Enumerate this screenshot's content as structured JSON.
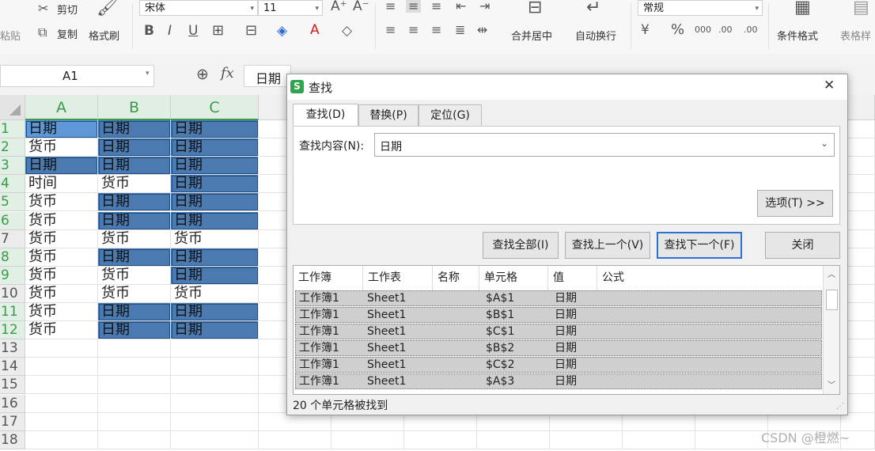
{
  "ribbon": {
    "paste_label": "粘贴",
    "cut_label": "剪切",
    "copy_label": "复制",
    "format_painter_label": "格式刷",
    "font_name": "宋体",
    "font_size": "11",
    "merge_center_label": "合并居中",
    "wrap_text_label": "自动换行",
    "number_format": "常规",
    "cond_format_label": "条件格式",
    "table_style_label": "表格样"
  },
  "formula_bar": {
    "name_box": "A1",
    "fx_label": "fx",
    "content": "日期"
  },
  "sheet": {
    "columns": [
      "A",
      "B",
      "C"
    ],
    "rows": [
      {
        "num": "1",
        "cells": [
          "日期",
          "日期",
          "日期"
        ],
        "hi": [
          true,
          true,
          true
        ],
        "sel": true
      },
      {
        "num": "2",
        "cells": [
          "货币",
          "日期",
          "日期"
        ],
        "hi": [
          false,
          true,
          true
        ],
        "sel": true
      },
      {
        "num": "3",
        "cells": [
          "日期",
          "日期",
          "日期"
        ],
        "hi": [
          true,
          true,
          true
        ],
        "sel": true
      },
      {
        "num": "4",
        "cells": [
          "时间",
          "货币",
          "日期"
        ],
        "hi": [
          false,
          false,
          true
        ],
        "sel": true
      },
      {
        "num": "5",
        "cells": [
          "货币",
          "日期",
          "日期"
        ],
        "hi": [
          false,
          true,
          true
        ],
        "sel": true
      },
      {
        "num": "6",
        "cells": [
          "货币",
          "日期",
          "日期"
        ],
        "hi": [
          false,
          true,
          true
        ],
        "sel": true
      },
      {
        "num": "7",
        "cells": [
          "货币",
          "货币",
          "货币"
        ],
        "hi": [
          false,
          false,
          false
        ],
        "sel": false
      },
      {
        "num": "8",
        "cells": [
          "货币",
          "日期",
          "日期"
        ],
        "hi": [
          false,
          true,
          true
        ],
        "sel": true
      },
      {
        "num": "9",
        "cells": [
          "货币",
          "货币",
          "日期"
        ],
        "hi": [
          false,
          false,
          true
        ],
        "sel": true
      },
      {
        "num": "10",
        "cells": [
          "货币",
          "货币",
          "货币"
        ],
        "hi": [
          false,
          false,
          false
        ],
        "sel": false
      },
      {
        "num": "11",
        "cells": [
          "货币",
          "日期",
          "日期"
        ],
        "hi": [
          false,
          true,
          true
        ],
        "sel": true
      },
      {
        "num": "12",
        "cells": [
          "货币",
          "日期",
          "日期"
        ],
        "hi": [
          false,
          true,
          true
        ],
        "sel": true
      },
      {
        "num": "13",
        "cells": [
          "",
          "",
          ""
        ],
        "hi": [
          false,
          false,
          false
        ],
        "sel": false
      },
      {
        "num": "14",
        "cells": [
          "",
          "",
          ""
        ],
        "hi": [
          false,
          false,
          false
        ],
        "sel": false
      },
      {
        "num": "15",
        "cells": [
          "",
          "",
          ""
        ],
        "hi": [
          false,
          false,
          false
        ],
        "sel": false
      },
      {
        "num": "16",
        "cells": [
          "",
          "",
          ""
        ],
        "hi": [
          false,
          false,
          false
        ],
        "sel": false
      },
      {
        "num": "17",
        "cells": [
          "",
          "",
          ""
        ],
        "hi": [
          false,
          false,
          false
        ],
        "sel": false
      },
      {
        "num": "18",
        "cells": [
          "",
          "",
          ""
        ],
        "hi": [
          false,
          false,
          false
        ],
        "sel": false
      }
    ]
  },
  "dialog": {
    "title": "查找",
    "close_glyph": "✕",
    "tabs": [
      "查找(D)",
      "替换(P)",
      "定位(G)"
    ],
    "find_label": "查找内容(N):",
    "find_value": "日期",
    "options_button": "选项(T) >>",
    "find_all_button": "查找全部(I)",
    "find_prev_button": "查找上一个(V)",
    "find_next_button": "查找下一个(F)",
    "close_button": "关闭",
    "result_headers": [
      "工作簿",
      "工作表",
      "名称",
      "单元格",
      "值",
      "公式"
    ],
    "results": [
      {
        "book": "工作簿1",
        "sheet": "Sheet1",
        "name": "",
        "cell": "$A$1",
        "value": "日期"
      },
      {
        "book": "工作簿1",
        "sheet": "Sheet1",
        "name": "",
        "cell": "$B$1",
        "value": "日期"
      },
      {
        "book": "工作簿1",
        "sheet": "Sheet1",
        "name": "",
        "cell": "$C$1",
        "value": "日期"
      },
      {
        "book": "工作簿1",
        "sheet": "Sheet1",
        "name": "",
        "cell": "$B$2",
        "value": "日期"
      },
      {
        "book": "工作簿1",
        "sheet": "Sheet1",
        "name": "",
        "cell": "$C$2",
        "value": "日期"
      },
      {
        "book": "工作簿1",
        "sheet": "Sheet1",
        "name": "",
        "cell": "$A$3",
        "value": "日期"
      }
    ],
    "status": "20 个单元格被找到"
  },
  "watermark": "CSDN @橙燃~",
  "colors": {
    "accent_green": "#3a9a4c",
    "highlight_blue": "#4a7ab0",
    "focus_blue": "#2d6fd2"
  }
}
